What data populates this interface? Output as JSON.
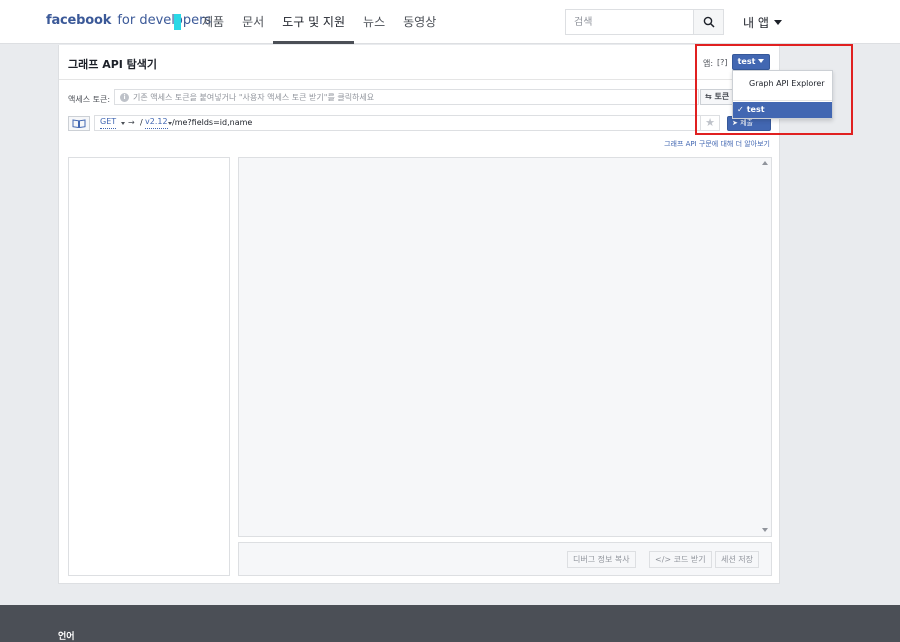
{
  "header": {
    "brand_primary": "facebook",
    "brand_secondary": "for developers",
    "nav": [
      "제품",
      "문서",
      "도구 및 지원",
      "뉴스",
      "동영상"
    ],
    "active_nav": "도구 및 지원",
    "search_placeholder": "검색",
    "my_apps": "내 앱",
    "brand_accent_color": "#29d8e6"
  },
  "explorer": {
    "title": "그래프 API 탐색기",
    "app_label": "앱:",
    "app_help": "[?]",
    "app_selected": "test",
    "token_label": "액세스 토큰:",
    "token_placeholder": "기존 액세스 토큰을 붙여넣거나 \"사용자 액세스 토큰 받기\"를 클릭하세요",
    "token_button": "⇆ 토큰 받기",
    "method": "GET",
    "arrow": "→",
    "slash": "/",
    "version": "v2.12",
    "path": "/me?fields=id,name",
    "submit": "➤ 제출",
    "learn_more": "그래프 API 구문에 대해 더 알아보기",
    "actions": {
      "copy_debug": "디버그 정보 복사",
      "get_code": "</> 코드 받기",
      "save_session": "세션 저장"
    }
  },
  "app_dropdown": {
    "items": [
      {
        "label": "Graph API Explorer",
        "selected": false
      },
      {
        "label": "test",
        "selected": true
      }
    ],
    "check": "✓"
  },
  "footer": {
    "language": "언어"
  },
  "colors": {
    "primary": "#4267b2",
    "highlight": "#e02020",
    "footer_bg": "#4b4f56"
  }
}
